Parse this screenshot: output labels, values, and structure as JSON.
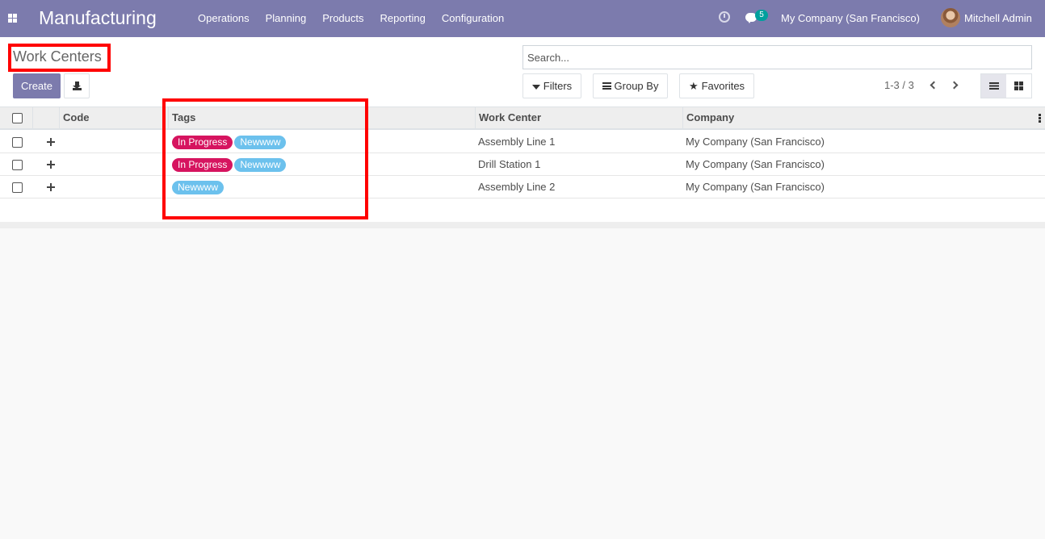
{
  "navbar": {
    "brand": "Manufacturing",
    "menu": [
      "Operations",
      "Planning",
      "Products",
      "Reporting",
      "Configuration"
    ],
    "chat_count": "5",
    "company": "My Company (San Francisco)",
    "user": "Mitchell Admin",
    "icons": [
      "apps-icon",
      "clock-icon",
      "chat-icon",
      "avatar"
    ]
  },
  "control_panel": {
    "breadcrumb": "Work Centers",
    "create_label": "Create",
    "search_placeholder": "Search...",
    "filters_label": "Filters",
    "groupby_label": "Group By",
    "favorites_label": "Favorites",
    "pager": "1-3 / 3"
  },
  "table": {
    "headers": {
      "code": "Code",
      "tags": "Tags",
      "work_center": "Work Center",
      "company": "Company"
    },
    "rows": [
      {
        "code": "",
        "tags": [
          "In Progress",
          "Newwww"
        ],
        "work_center": "Assembly Line 1",
        "company": "My Company (San Francisco)"
      },
      {
        "code": "",
        "tags": [
          "In Progress",
          "Newwww"
        ],
        "work_center": "Drill Station 1",
        "company": "My Company (San Francisco)"
      },
      {
        "code": "",
        "tags": [
          "Newwww"
        ],
        "work_center": "Assembly Line 2",
        "company": "My Company (San Francisco)"
      }
    ]
  },
  "colors": {
    "navbar": "#7c7bad",
    "tag_in_progress": "#d6145f",
    "tag_newwww": "#6cc1ed",
    "highlight": "#ff0000"
  }
}
